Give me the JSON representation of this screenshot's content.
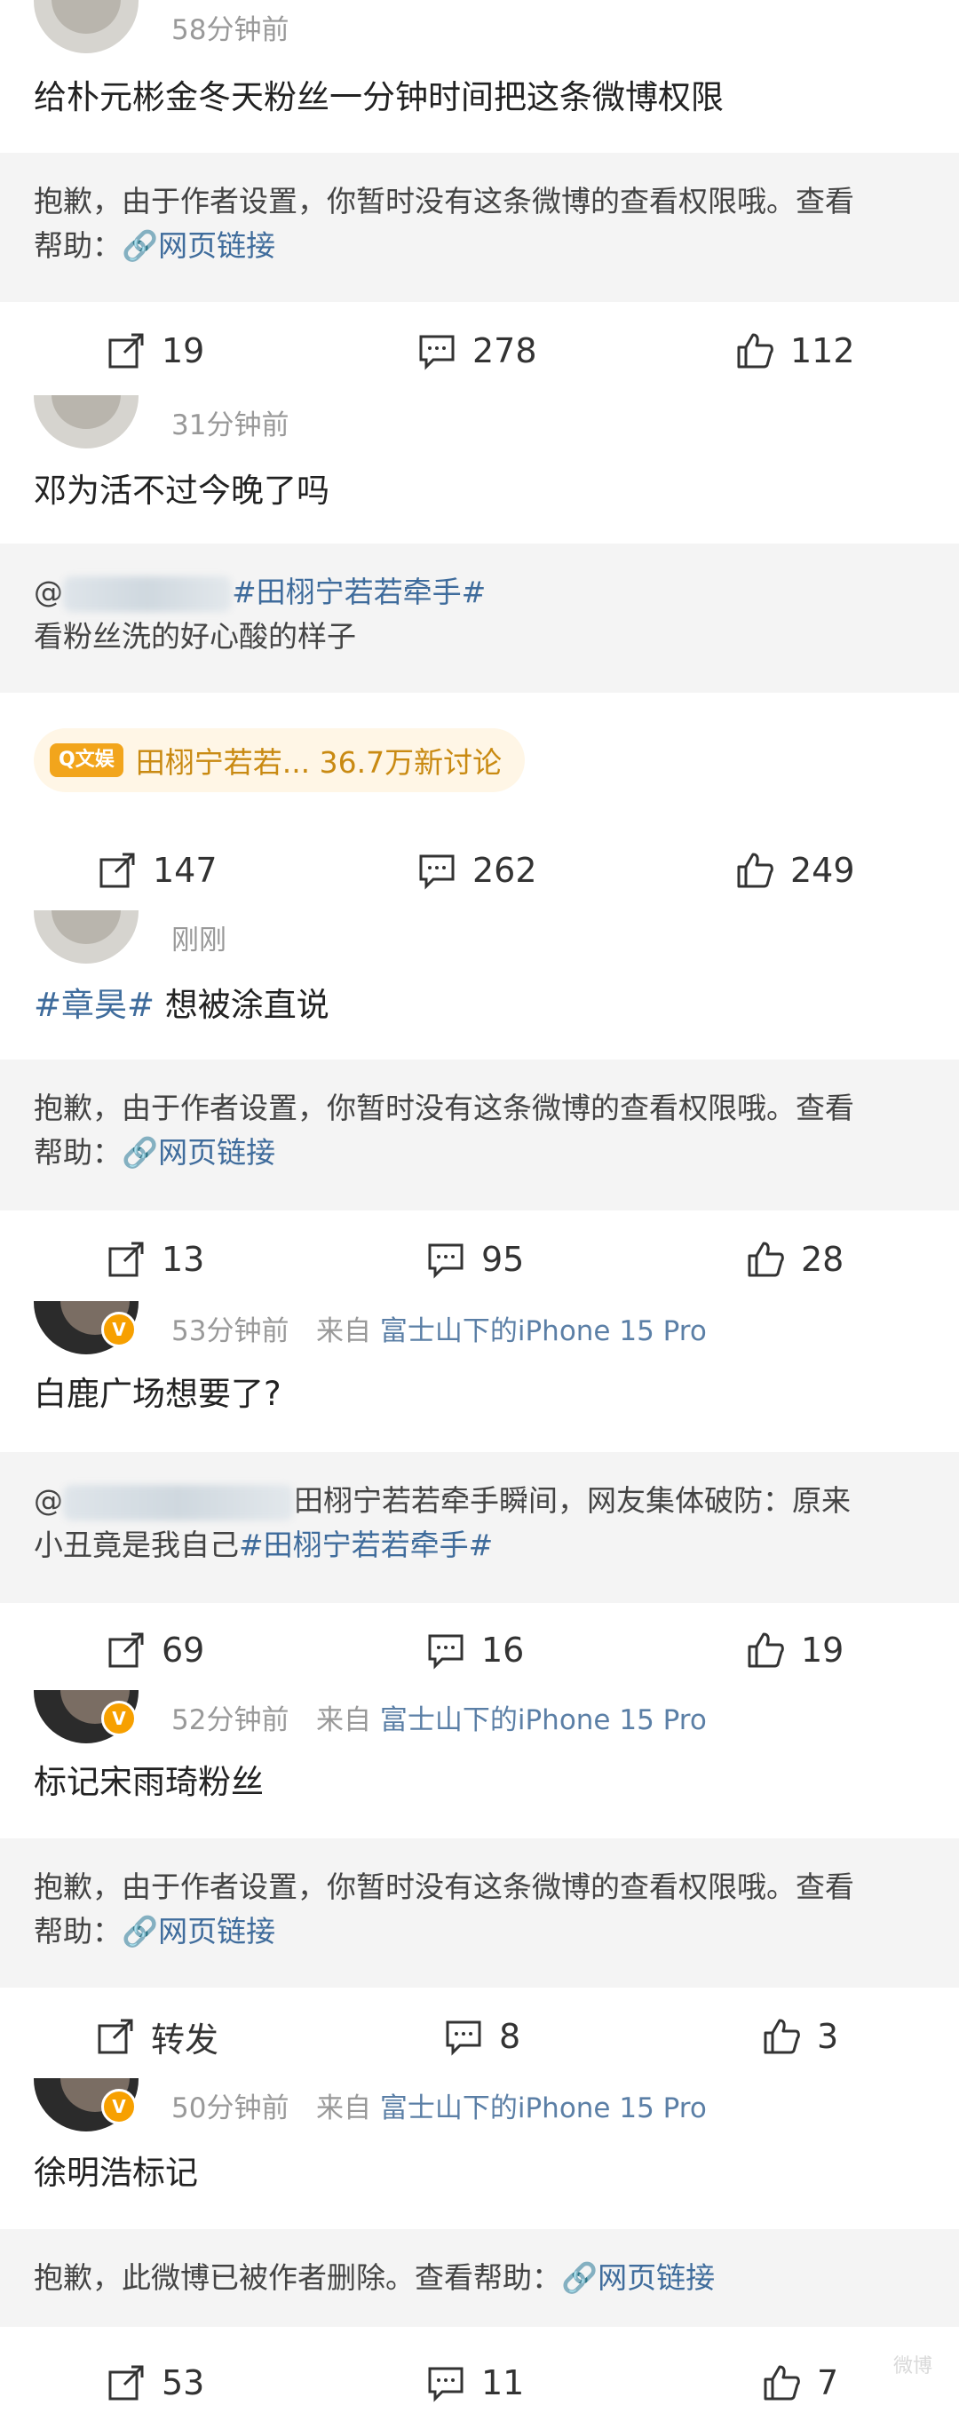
{
  "posts": [
    {
      "time": "58分钟前",
      "text": "给朴元彬金冬天粉丝一分钟时间把这条微博权限",
      "quote": {
        "notice": "抱歉，由于作者设置，你暂时没有这条微博的查看权限哦。查看",
        "help": "帮助：",
        "link": "网页链接"
      },
      "repost": "19",
      "comment": "278",
      "like": "112"
    },
    {
      "time": "31分钟前",
      "text": "邓为活不过今晚了吗",
      "quote": {
        "mention": "@",
        "topic": "#田栩宁若若牵手#",
        "body": "看粉丝洗的好心酸的样子"
      },
      "pill": {
        "tag": "Q文娱",
        "text": "田栩宁若若... 36.7万新讨论"
      },
      "repost": "147",
      "comment": "262",
      "like": "249"
    },
    {
      "time": "刚刚",
      "topic": "#章昊#",
      "text": " 想被涂直说",
      "quote": {
        "notice": "抱歉，由于作者设置，你暂时没有这条微博的查看权限哦。查看",
        "help": "帮助：",
        "link": "网页链接"
      },
      "repost": "13",
      "comment": "95",
      "like": "28"
    },
    {
      "time": "53分钟前",
      "source_prefix": "来自",
      "device": "富士山下的iPhone 15 Pro",
      "text": "白鹿广场想要了?",
      "quote": {
        "mention": "@",
        "line1": "田栩宁若若牵手瞬间，网友集体破防：原来",
        "line2": "小丑竟是我自己",
        "topic": "#田栩宁若若牵手#"
      },
      "repost": "69",
      "comment": "16",
      "like": "19"
    },
    {
      "time": "52分钟前",
      "source_prefix": "来自",
      "device": "富士山下的iPhone 15 Pro",
      "text": "标记宋雨琦粉丝",
      "quote": {
        "notice": "抱歉，由于作者设置，你暂时没有这条微博的查看权限哦。查看",
        "help": "帮助：",
        "link": "网页链接"
      },
      "repost": "转发",
      "comment": "8",
      "like": "3"
    },
    {
      "time": "50分钟前",
      "source_prefix": "来自",
      "device": "富士山下的iPhone 15 Pro",
      "text": "徐明浩标记",
      "quote": {
        "notice": "抱歉，此微博已被作者删除。查看帮助：",
        "link": "网页链接"
      },
      "repost": "53",
      "comment": "11",
      "like": "7"
    }
  ],
  "badge": "V",
  "watermark": "微博"
}
